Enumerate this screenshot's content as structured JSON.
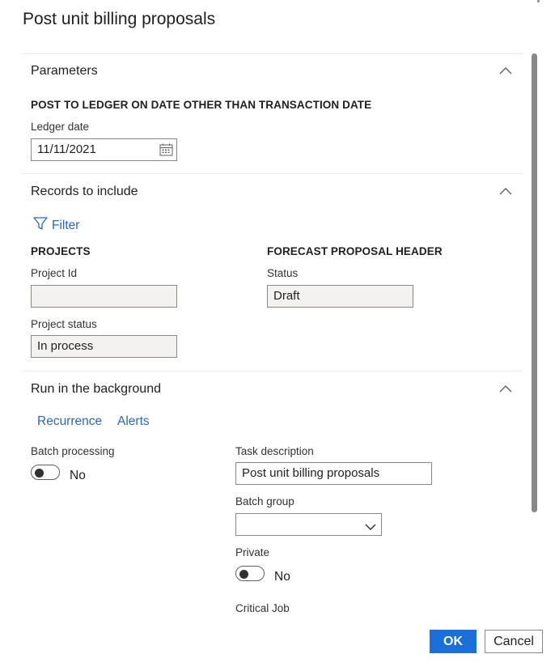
{
  "dialog": {
    "title": "Post unit billing proposals"
  },
  "parameters": {
    "header": "Parameters",
    "group_label": "POST TO LEDGER ON DATE OTHER THAN TRANSACTION DATE",
    "ledger_date_label": "Ledger date",
    "ledger_date_value": "11/11/2021"
  },
  "records": {
    "header": "Records to include",
    "filter_label": "Filter",
    "projects_group": "PROJECTS",
    "project_id_label": "Project Id",
    "project_id_value": "",
    "project_status_label": "Project status",
    "project_status_value": "In process",
    "forecast_group": "FORECAST PROPOSAL HEADER",
    "status_label": "Status",
    "status_value": "Draft"
  },
  "background": {
    "header": "Run in the background",
    "recurrence_label": "Recurrence",
    "alerts_label": "Alerts",
    "batch_processing_label": "Batch processing",
    "batch_processing_value": "No",
    "task_description_label": "Task description",
    "task_description_value": "Post unit billing proposals",
    "batch_group_label": "Batch group",
    "batch_group_value": "",
    "private_label": "Private",
    "private_value": "No",
    "critical_job_label": "Critical Job"
  },
  "footer": {
    "ok_label": "OK",
    "cancel_label": "Cancel"
  },
  "colors": {
    "accent": "#1a6fd8",
    "link": "#2a67c4",
    "readonly_bg": "#f3f2f1"
  },
  "icons": {
    "collapse": "chevron-up-icon",
    "calendar": "calendar-icon",
    "filter": "filter-icon",
    "dropdown": "chevron-down-icon"
  }
}
